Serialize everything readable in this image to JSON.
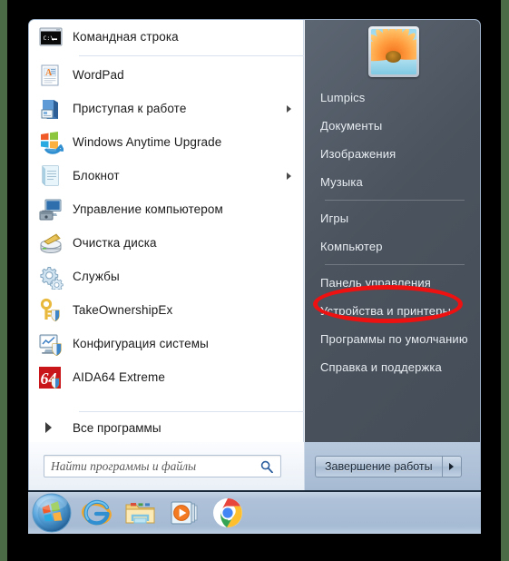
{
  "window": {
    "title": "Windows 7 Start Menu"
  },
  "start_menu": {
    "programs": [
      {
        "label": "Командная строка",
        "icon": "command-prompt-icon",
        "submenu": false,
        "separator_after": true
      },
      {
        "label": "WordPad",
        "icon": "wordpad-icon",
        "submenu": false,
        "separator_after": false
      },
      {
        "label": "Приступая к работе",
        "icon": "getting-started-icon",
        "submenu": true,
        "separator_after": false
      },
      {
        "label": "Windows Anytime Upgrade",
        "icon": "windows-upgrade-icon",
        "submenu": false,
        "separator_after": false
      },
      {
        "label": "Блокнот",
        "icon": "notepad-icon",
        "submenu": true,
        "separator_after": false
      },
      {
        "label": "Управление компьютером",
        "icon": "computer-management-icon",
        "submenu": false,
        "separator_after": false
      },
      {
        "label": "Очистка диска",
        "icon": "disk-cleanup-icon",
        "submenu": false,
        "separator_after": false
      },
      {
        "label": "Службы",
        "icon": "services-icon",
        "submenu": false,
        "separator_after": false
      },
      {
        "label": "TakeOwnershipEx",
        "icon": "take-ownership-icon",
        "submenu": false,
        "separator_after": false
      },
      {
        "label": "Конфигурация системы",
        "icon": "system-config-icon",
        "submenu": false,
        "separator_after": false
      },
      {
        "label": "AIDA64 Extreme",
        "icon": "aida64-icon",
        "submenu": false,
        "separator_after": false
      }
    ],
    "all_programs_label": "Все программы",
    "search": {
      "placeholder": "Найти программы и файлы",
      "value": "",
      "icon": "search-icon"
    },
    "shutdown": {
      "label": "Завершение работы",
      "more_icon": "chevron-right-icon"
    },
    "right_panel": {
      "avatar": "user-avatar-flower",
      "items": [
        {
          "label": "Lumpics",
          "separator_after": false
        },
        {
          "label": "Документы",
          "separator_after": false
        },
        {
          "label": "Изображения",
          "separator_after": false
        },
        {
          "label": "Музыка",
          "separator_after": true
        },
        {
          "label": "Игры",
          "separator_after": false
        },
        {
          "label": "Компьютер",
          "separator_after": true
        },
        {
          "label": "Панель управления",
          "separator_after": false,
          "highlighted": true
        },
        {
          "label": "Устройства и принтеры",
          "separator_after": false
        },
        {
          "label": "Программы по умолчанию",
          "separator_after": false
        },
        {
          "label": "Справка и поддержка",
          "separator_after": false
        }
      ]
    }
  },
  "taskbar": {
    "items": [
      {
        "name": "start-orb-icon",
        "label": "Пуск"
      },
      {
        "name": "internet-explorer-icon",
        "label": "Internet Explorer"
      },
      {
        "name": "file-explorer-icon",
        "label": "Проводник"
      },
      {
        "name": "media-player-icon",
        "label": "Проигрыватель Windows Media"
      },
      {
        "name": "google-chrome-icon",
        "label": "Google Chrome"
      }
    ]
  },
  "annotation": {
    "shape": "ellipse",
    "color": "#ee1111",
    "target": "Панель управления"
  },
  "colors": {
    "menu_left_bg": "#ffffff",
    "menu_right_bg": "#4b535e",
    "taskbar": "#aec1d8",
    "annotation": "#ee1111",
    "desktop": "#4a6b46"
  }
}
